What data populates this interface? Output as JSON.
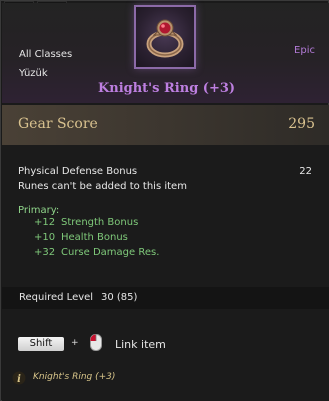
{
  "header": {
    "class_restriction": "All Classes",
    "item_type": "Yüzük",
    "rarity": "Epic",
    "item_name": "Knight's Ring (+3)",
    "item_icon": "ring-icon"
  },
  "gear_score": {
    "label": "Gear Score",
    "value": "295"
  },
  "stats": {
    "physical_defense_label": "Physical Defense Bonus",
    "physical_defense_value": "22",
    "runes_note": "Runes can't be added to this item"
  },
  "primary": {
    "heading": "Primary:",
    "attributes": [
      {
        "value": "+12",
        "name": "Strength Bonus"
      },
      {
        "value": "+10",
        "name": "Health Bonus"
      },
      {
        "value": "+32",
        "name": "Curse Damage Res."
      }
    ]
  },
  "requirement": {
    "label": "Required Level",
    "value": "30 (85)"
  },
  "link_hint": {
    "key": "Shift",
    "plus": "+",
    "action": "Link item",
    "mouse_icon": "mouse-left-click-icon"
  },
  "footer": {
    "text": "Knight's Ring (+3)",
    "icon": "info-icon"
  },
  "colors": {
    "epic": "#bd7fe0",
    "gear_score": "#d9c28f",
    "bonus": "#7fc97a",
    "footer": "#d8c58a"
  }
}
